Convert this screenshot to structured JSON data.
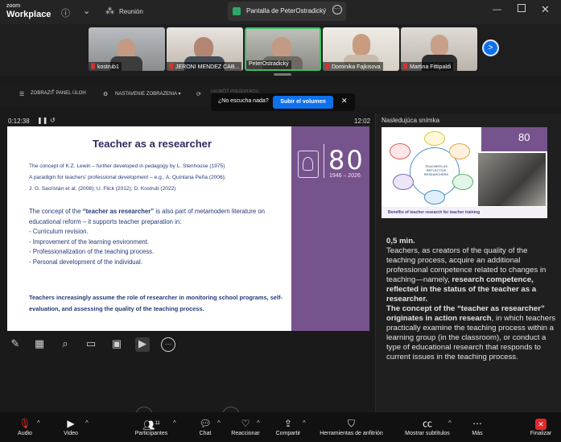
{
  "app": {
    "logo_line1": "zoom",
    "logo_line2": "Workplace"
  },
  "topbar": {
    "meeting_label": "Reunión",
    "shared_screen_tab": "Pantalla de PeterOstradický"
  },
  "participants": [
    {
      "name": "kostrub1"
    },
    {
      "name": "JERONI MENDEZ CAB..."
    },
    {
      "name": "PeterOstradický"
    },
    {
      "name": "Dominika Fajkisova"
    },
    {
      "name": "Martina Fittipaldi"
    }
  ],
  "toolbar2": {
    "task_panel": "ZOBRAZIŤ PANEL ÚLOH",
    "view_settings": "NASTAVENIE ZOBRAZENIA ▾",
    "cut_text": "UKONČIŤ PREZENTÁCIU"
  },
  "audio_toast": {
    "message": "¿No escucha nada?",
    "button": "Subir el volumen"
  },
  "presenter": {
    "elapsed": "0:12:38",
    "clock": "12:02",
    "next_slide_label": "Nasledujúca snímka"
  },
  "slide": {
    "title": "Teacher as a researcher",
    "refs_1": "The concept of K.Z. Lewin – further developed in pedagogy by L. Stenhouse (1975)",
    "refs_2": "A paradigm for teachers' professional development – e.g., A. Quintana Peña (2006);",
    "refs_3": "J. G. Sacristán et al. (2008); U. Flick (2012); D. Kostrub (2022)",
    "para_pre": "The concept of the ",
    "para_bold": "“teacher as researcher”",
    "para_post": " is also part of metamodern literature on educational reform – it supports teacher preparation in:",
    "bullets": [
      "Curriculum revision.",
      "Improvement of the learning environment.",
      "Professionalization of the teaching process.",
      "Personal development of the individual."
    ],
    "emphasis": "Teachers increasingly assume the role of researcher in monitoring school programs, self-evaluation, and assessing the quality of the teaching process.",
    "anniv_number": "80",
    "anniv_years": "1946 – 2026"
  },
  "next_slide": {
    "center_text": "TEACHERS AS REFLECTIVE RESEARCHERS",
    "caption": "Benefits of teacher research for teacher training",
    "number": "80"
  },
  "notes": {
    "time": "0,5 min.",
    "t1": "Teachers, as creators of the quality of the teaching process, acquire an additional professional competence related to changes in teaching—namely, ",
    "t2": "research competence, reflected in the status of the teacher as a researcher.",
    "t3": "The concept of the “teacher as researcher” originates in action research",
    "t4": ", in which teachers practically examine the teaching process within a learning group (in the classroom), or conduct a type of educational research that responds to current issues in the teaching process."
  },
  "bottombar": {
    "audio": "Audio",
    "video": "Video",
    "participants": "Participantes",
    "participants_count": "11",
    "chat": "Chat",
    "react": "Reaccionar",
    "share": "Compartir",
    "host_tools": "Herramientas de anfitrión",
    "subtitles": "Mostrar subtítulos",
    "more": "Más",
    "end": "Finalizar"
  },
  "colors": {
    "accent": "#0e71eb",
    "slide_purple": "#76538d",
    "slide_text": "#253a7a",
    "end_red": "#e02828",
    "speaker_border": "#39c166"
  }
}
